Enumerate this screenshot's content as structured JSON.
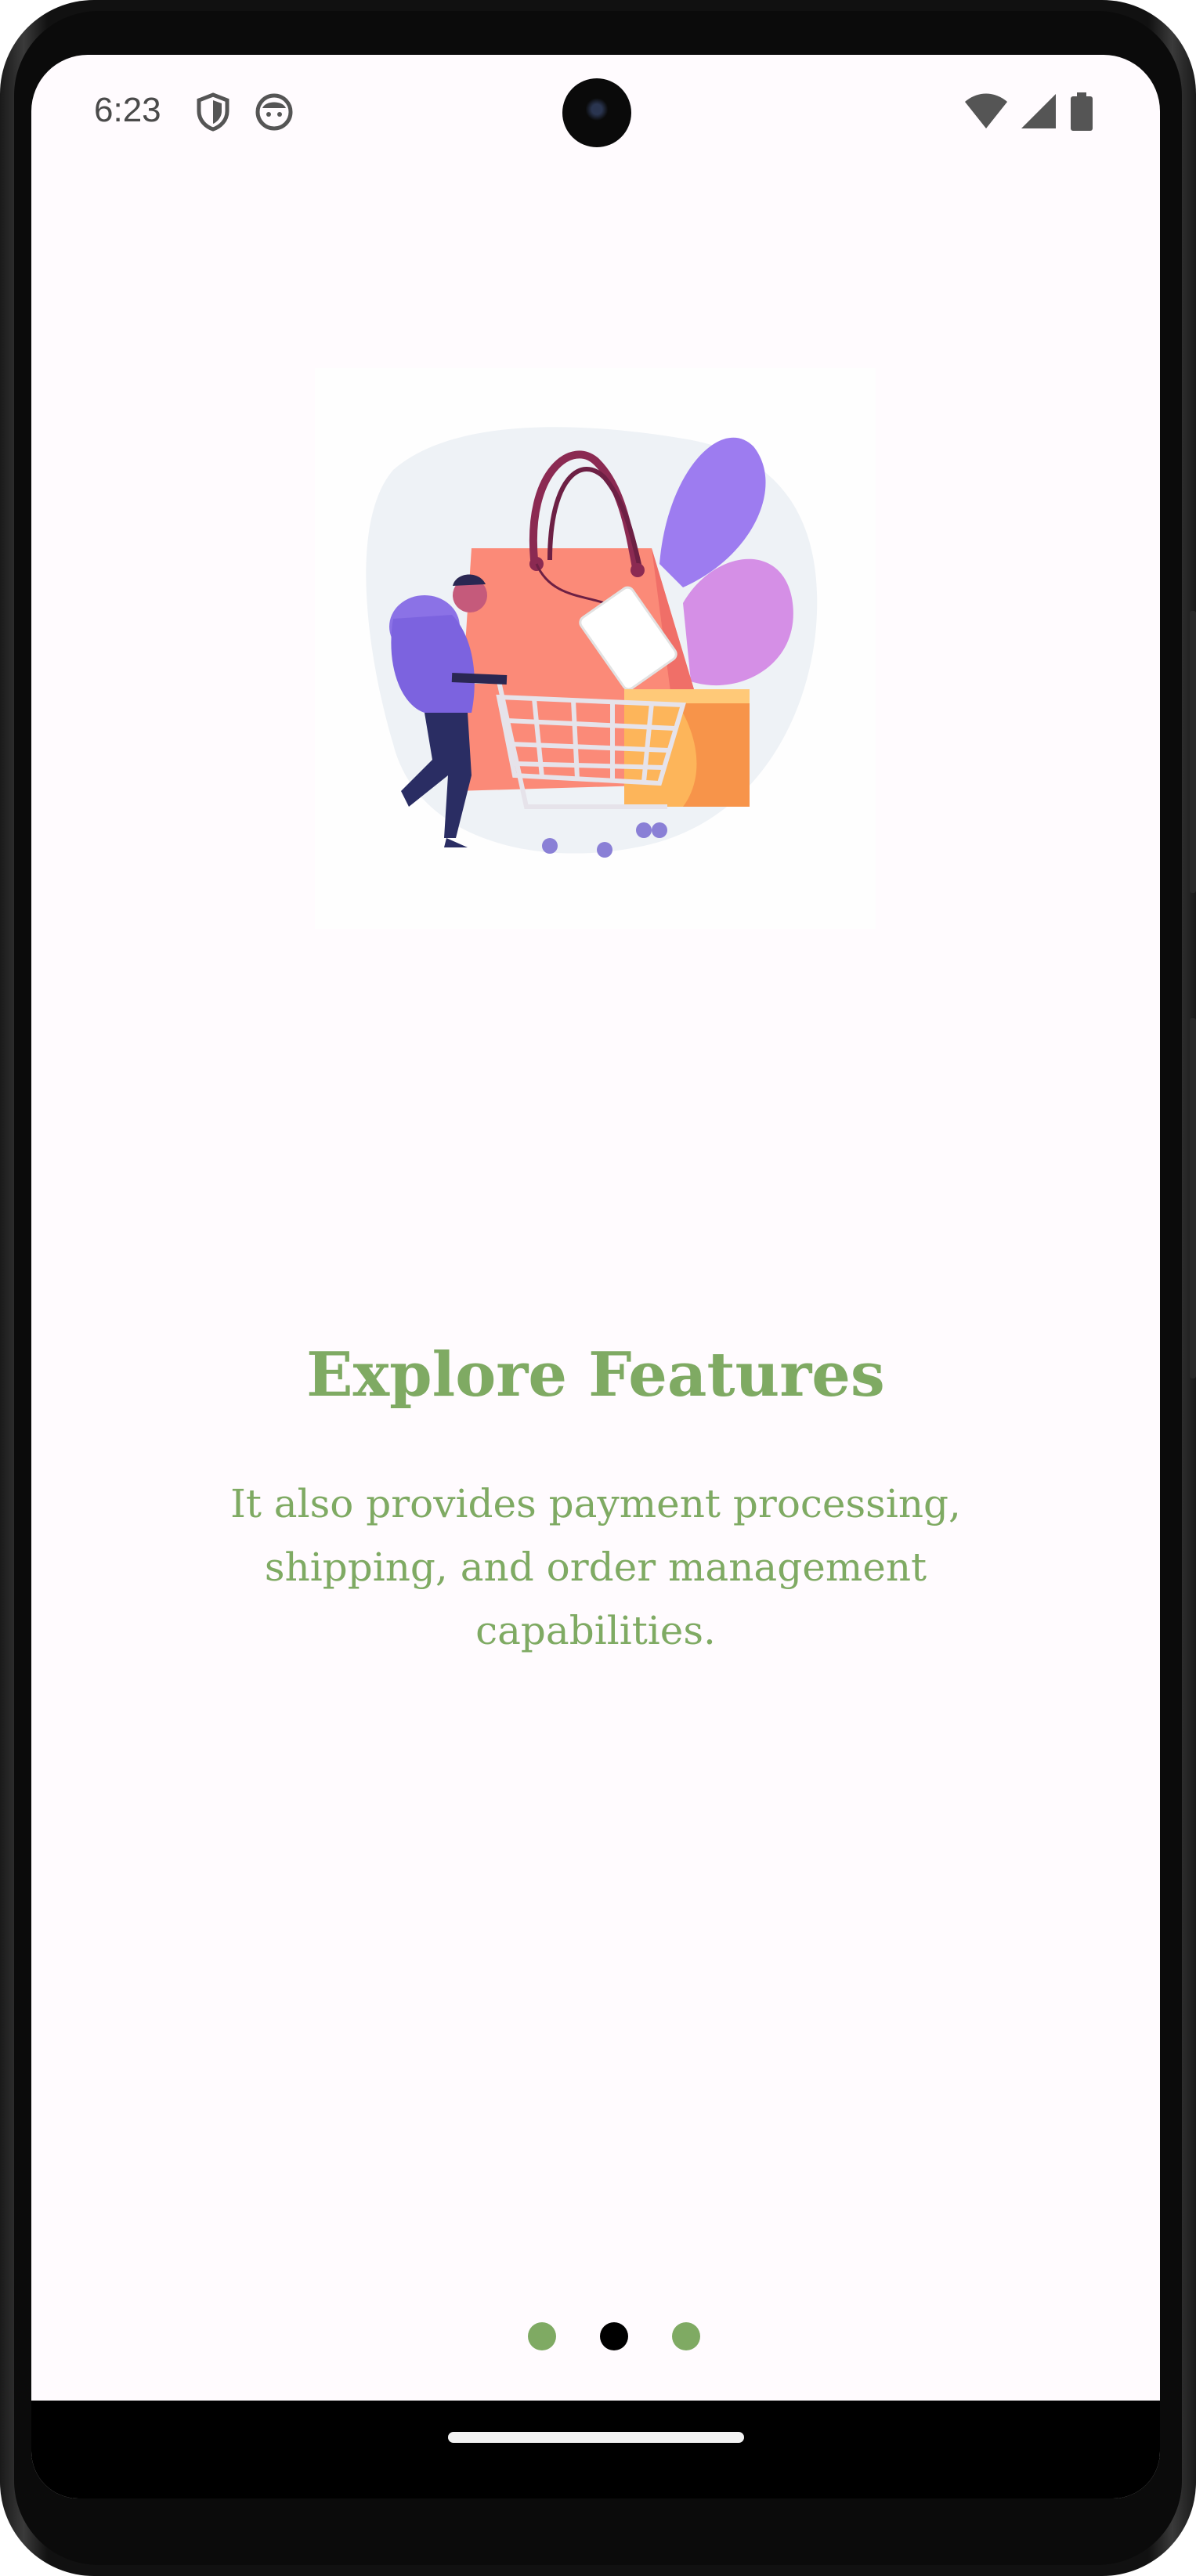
{
  "status_bar": {
    "time": "6:23",
    "left_icons": [
      "shield-icon",
      "face-icon"
    ],
    "right_icons": [
      "wifi-icon",
      "cell-signal-icon",
      "battery-icon"
    ]
  },
  "onboarding": {
    "illustration": "shopping-bag-cart-illustration",
    "title": "Explore Features",
    "description": "It also provides payment processing, shipping, and order management capabilities.",
    "page_indicator": {
      "count": 3,
      "active_index": 1
    }
  },
  "colors": {
    "accent_green": "#7faa63",
    "active_dot": "#000000",
    "screen_background": "#fffbfe"
  }
}
